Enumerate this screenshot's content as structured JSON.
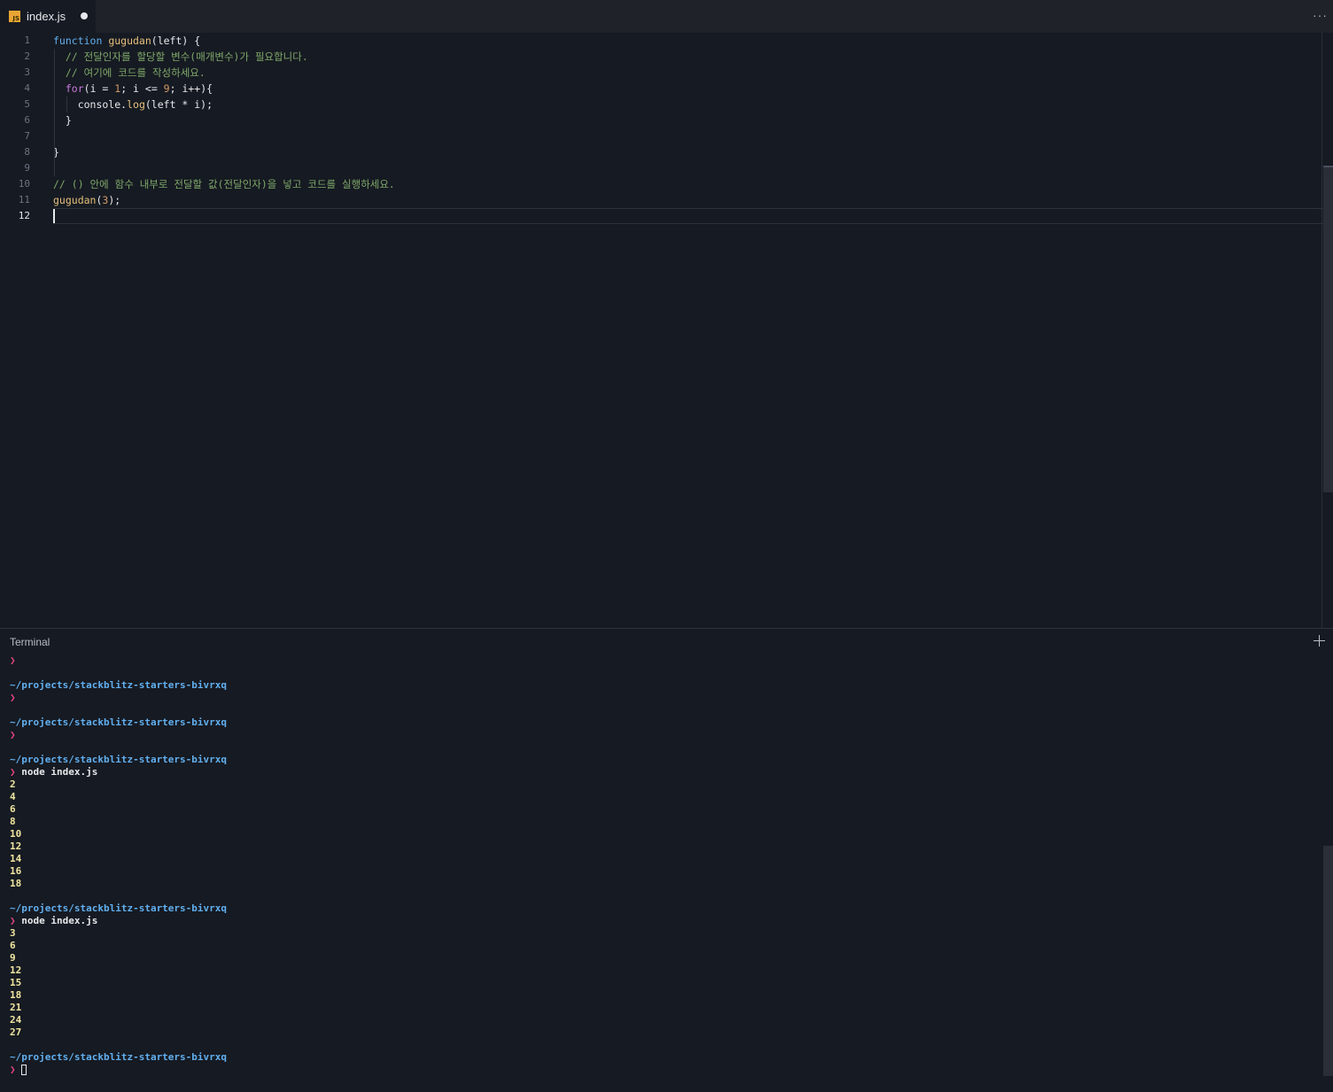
{
  "tab": {
    "filename": "index.js",
    "icon_label": "JS",
    "modified": true
  },
  "toolbar": {
    "more_label": "···"
  },
  "editor": {
    "active_line": 12,
    "lines": [
      {
        "n": "1",
        "tokens": [
          {
            "c": "kw2",
            "t": "function "
          },
          {
            "c": "fn",
            "t": "gugudan"
          },
          {
            "c": "id",
            "t": "(left) {"
          }
        ]
      },
      {
        "n": "2",
        "tokens": [
          {
            "c": "id",
            "t": "  "
          },
          {
            "c": "cm",
            "t": "// 전달인자를 할당할 변수(매개변수)가 필요합니다."
          }
        ]
      },
      {
        "n": "3",
        "tokens": [
          {
            "c": "id",
            "t": "  "
          },
          {
            "c": "cm",
            "t": "// 여기에 코드를 작성하세요."
          }
        ]
      },
      {
        "n": "4",
        "tokens": [
          {
            "c": "id",
            "t": "  "
          },
          {
            "c": "kw",
            "t": "for"
          },
          {
            "c": "id",
            "t": "(i = "
          },
          {
            "c": "num",
            "t": "1"
          },
          {
            "c": "id",
            "t": "; i <= "
          },
          {
            "c": "num",
            "t": "9"
          },
          {
            "c": "id",
            "t": "; i++){"
          }
        ]
      },
      {
        "n": "5",
        "tokens": [
          {
            "c": "id",
            "t": "    console."
          },
          {
            "c": "prop",
            "t": "log"
          },
          {
            "c": "id",
            "t": "(left * i);"
          }
        ]
      },
      {
        "n": "6",
        "tokens": [
          {
            "c": "id",
            "t": "  }"
          }
        ]
      },
      {
        "n": "7",
        "tokens": []
      },
      {
        "n": "8",
        "tokens": [
          {
            "c": "id",
            "t": "}"
          }
        ]
      },
      {
        "n": "9",
        "tokens": []
      },
      {
        "n": "10",
        "tokens": [
          {
            "c": "cm",
            "t": "// () 안에 함수 내부로 전달할 값(전달인자)을 넣고 코드를 실행하세요."
          }
        ]
      },
      {
        "n": "11",
        "tokens": [
          {
            "c": "fn",
            "t": "gugudan"
          },
          {
            "c": "id",
            "t": "("
          },
          {
            "c": "num",
            "t": "3"
          },
          {
            "c": "id",
            "t": ");"
          }
        ]
      },
      {
        "n": "12",
        "tokens": []
      }
    ]
  },
  "terminal": {
    "title": "Terminal",
    "lines": [
      {
        "k": "prompt",
        "t": "❯"
      },
      {
        "k": "blank",
        "t": ""
      },
      {
        "k": "path",
        "t": "~/projects/stackblitz-starters-bivrxq"
      },
      {
        "k": "prompt",
        "t": "❯"
      },
      {
        "k": "blank",
        "t": ""
      },
      {
        "k": "path",
        "t": "~/projects/stackblitz-starters-bivrxq"
      },
      {
        "k": "prompt",
        "t": "❯"
      },
      {
        "k": "blank",
        "t": ""
      },
      {
        "k": "path",
        "t": "~/projects/stackblitz-starters-bivrxq"
      },
      {
        "k": "cmd",
        "t": "node index.js"
      },
      {
        "k": "out",
        "t": "2"
      },
      {
        "k": "out",
        "t": "4"
      },
      {
        "k": "out",
        "t": "6"
      },
      {
        "k": "out",
        "t": "8"
      },
      {
        "k": "out",
        "t": "10"
      },
      {
        "k": "out",
        "t": "12"
      },
      {
        "k": "out",
        "t": "14"
      },
      {
        "k": "out",
        "t": "16"
      },
      {
        "k": "out",
        "t": "18"
      },
      {
        "k": "blank",
        "t": ""
      },
      {
        "k": "path",
        "t": "~/projects/stackblitz-starters-bivrxq"
      },
      {
        "k": "cmd",
        "t": "node index.js"
      },
      {
        "k": "out",
        "t": "3"
      },
      {
        "k": "out",
        "t": "6"
      },
      {
        "k": "out",
        "t": "9"
      },
      {
        "k": "out",
        "t": "12"
      },
      {
        "k": "out",
        "t": "15"
      },
      {
        "k": "out",
        "t": "18"
      },
      {
        "k": "out",
        "t": "21"
      },
      {
        "k": "out",
        "t": "24"
      },
      {
        "k": "out",
        "t": "27"
      },
      {
        "k": "blank",
        "t": ""
      },
      {
        "k": "path",
        "t": "~/projects/stackblitz-starters-bivrxq"
      },
      {
        "k": "input",
        "t": ""
      }
    ],
    "prompt_symbol": "❯"
  },
  "colors": {
    "background": "#161a22",
    "path": "#61afef",
    "prompt": "#e0457b",
    "output": "#f0e6a0"
  }
}
